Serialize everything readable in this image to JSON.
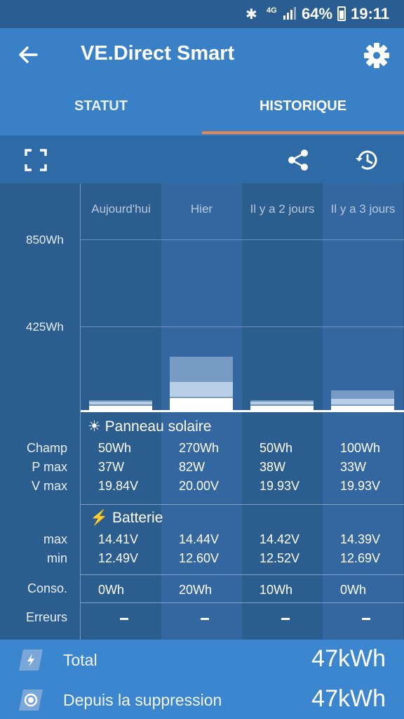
{
  "status_bar": {
    "network": "4G",
    "battery": "64%",
    "time": "19:11"
  },
  "app_bar": {
    "title": "VE.Direct Smart"
  },
  "tabs": [
    {
      "label": "STATUT",
      "active": false
    },
    {
      "label": "HISTORIQUE",
      "active": true
    }
  ],
  "chart": {
    "y_ticks": [
      "850Wh",
      "425Wh"
    ],
    "columns": [
      "Aujourd'hui",
      "Hier",
      "Il y a 2 jours",
      "Il y a 3 jours"
    ]
  },
  "chart_data": {
    "type": "bar",
    "categories": [
      "Aujourd'hui",
      "Hier",
      "Il y a 2 jours",
      "Il y a 3 jours"
    ],
    "ylabel": "",
    "ylim": [
      0,
      1000
    ],
    "y_tick_values": [
      425,
      850
    ],
    "series": [
      {
        "values": [
          50,
          270,
          50,
          100
        ]
      }
    ]
  },
  "solar": {
    "title": "Panneau solaire",
    "labels": [
      "Champ",
      "P max",
      "V max"
    ],
    "rows": [
      [
        "50Wh",
        "270Wh",
        "50Wh",
        "100Wh"
      ],
      [
        "37W",
        "82W",
        "38W",
        "33W"
      ],
      [
        "19.84V",
        "20.00V",
        "19.93V",
        "19.93V"
      ]
    ]
  },
  "battery": {
    "title": "Batterie",
    "labels": [
      "max",
      "min"
    ],
    "rows": [
      [
        "14.41V",
        "14.44V",
        "14.42V",
        "14.39V"
      ],
      [
        "12.49V",
        "12.60V",
        "12.52V",
        "12.69V"
      ]
    ]
  },
  "conso": {
    "label": "Conso.",
    "values": [
      "0Wh",
      "20Wh",
      "10Wh",
      "0Wh"
    ]
  },
  "errors": {
    "label": "Erreurs"
  },
  "footer": {
    "total_label": "Total",
    "total_value": "47kWh",
    "since_label": "Depuis la suppression",
    "since_value": "47kWh"
  },
  "colors": {
    "accent": "#e8874b",
    "appbar": "#3a80c6",
    "footer": "#3c85cf"
  }
}
